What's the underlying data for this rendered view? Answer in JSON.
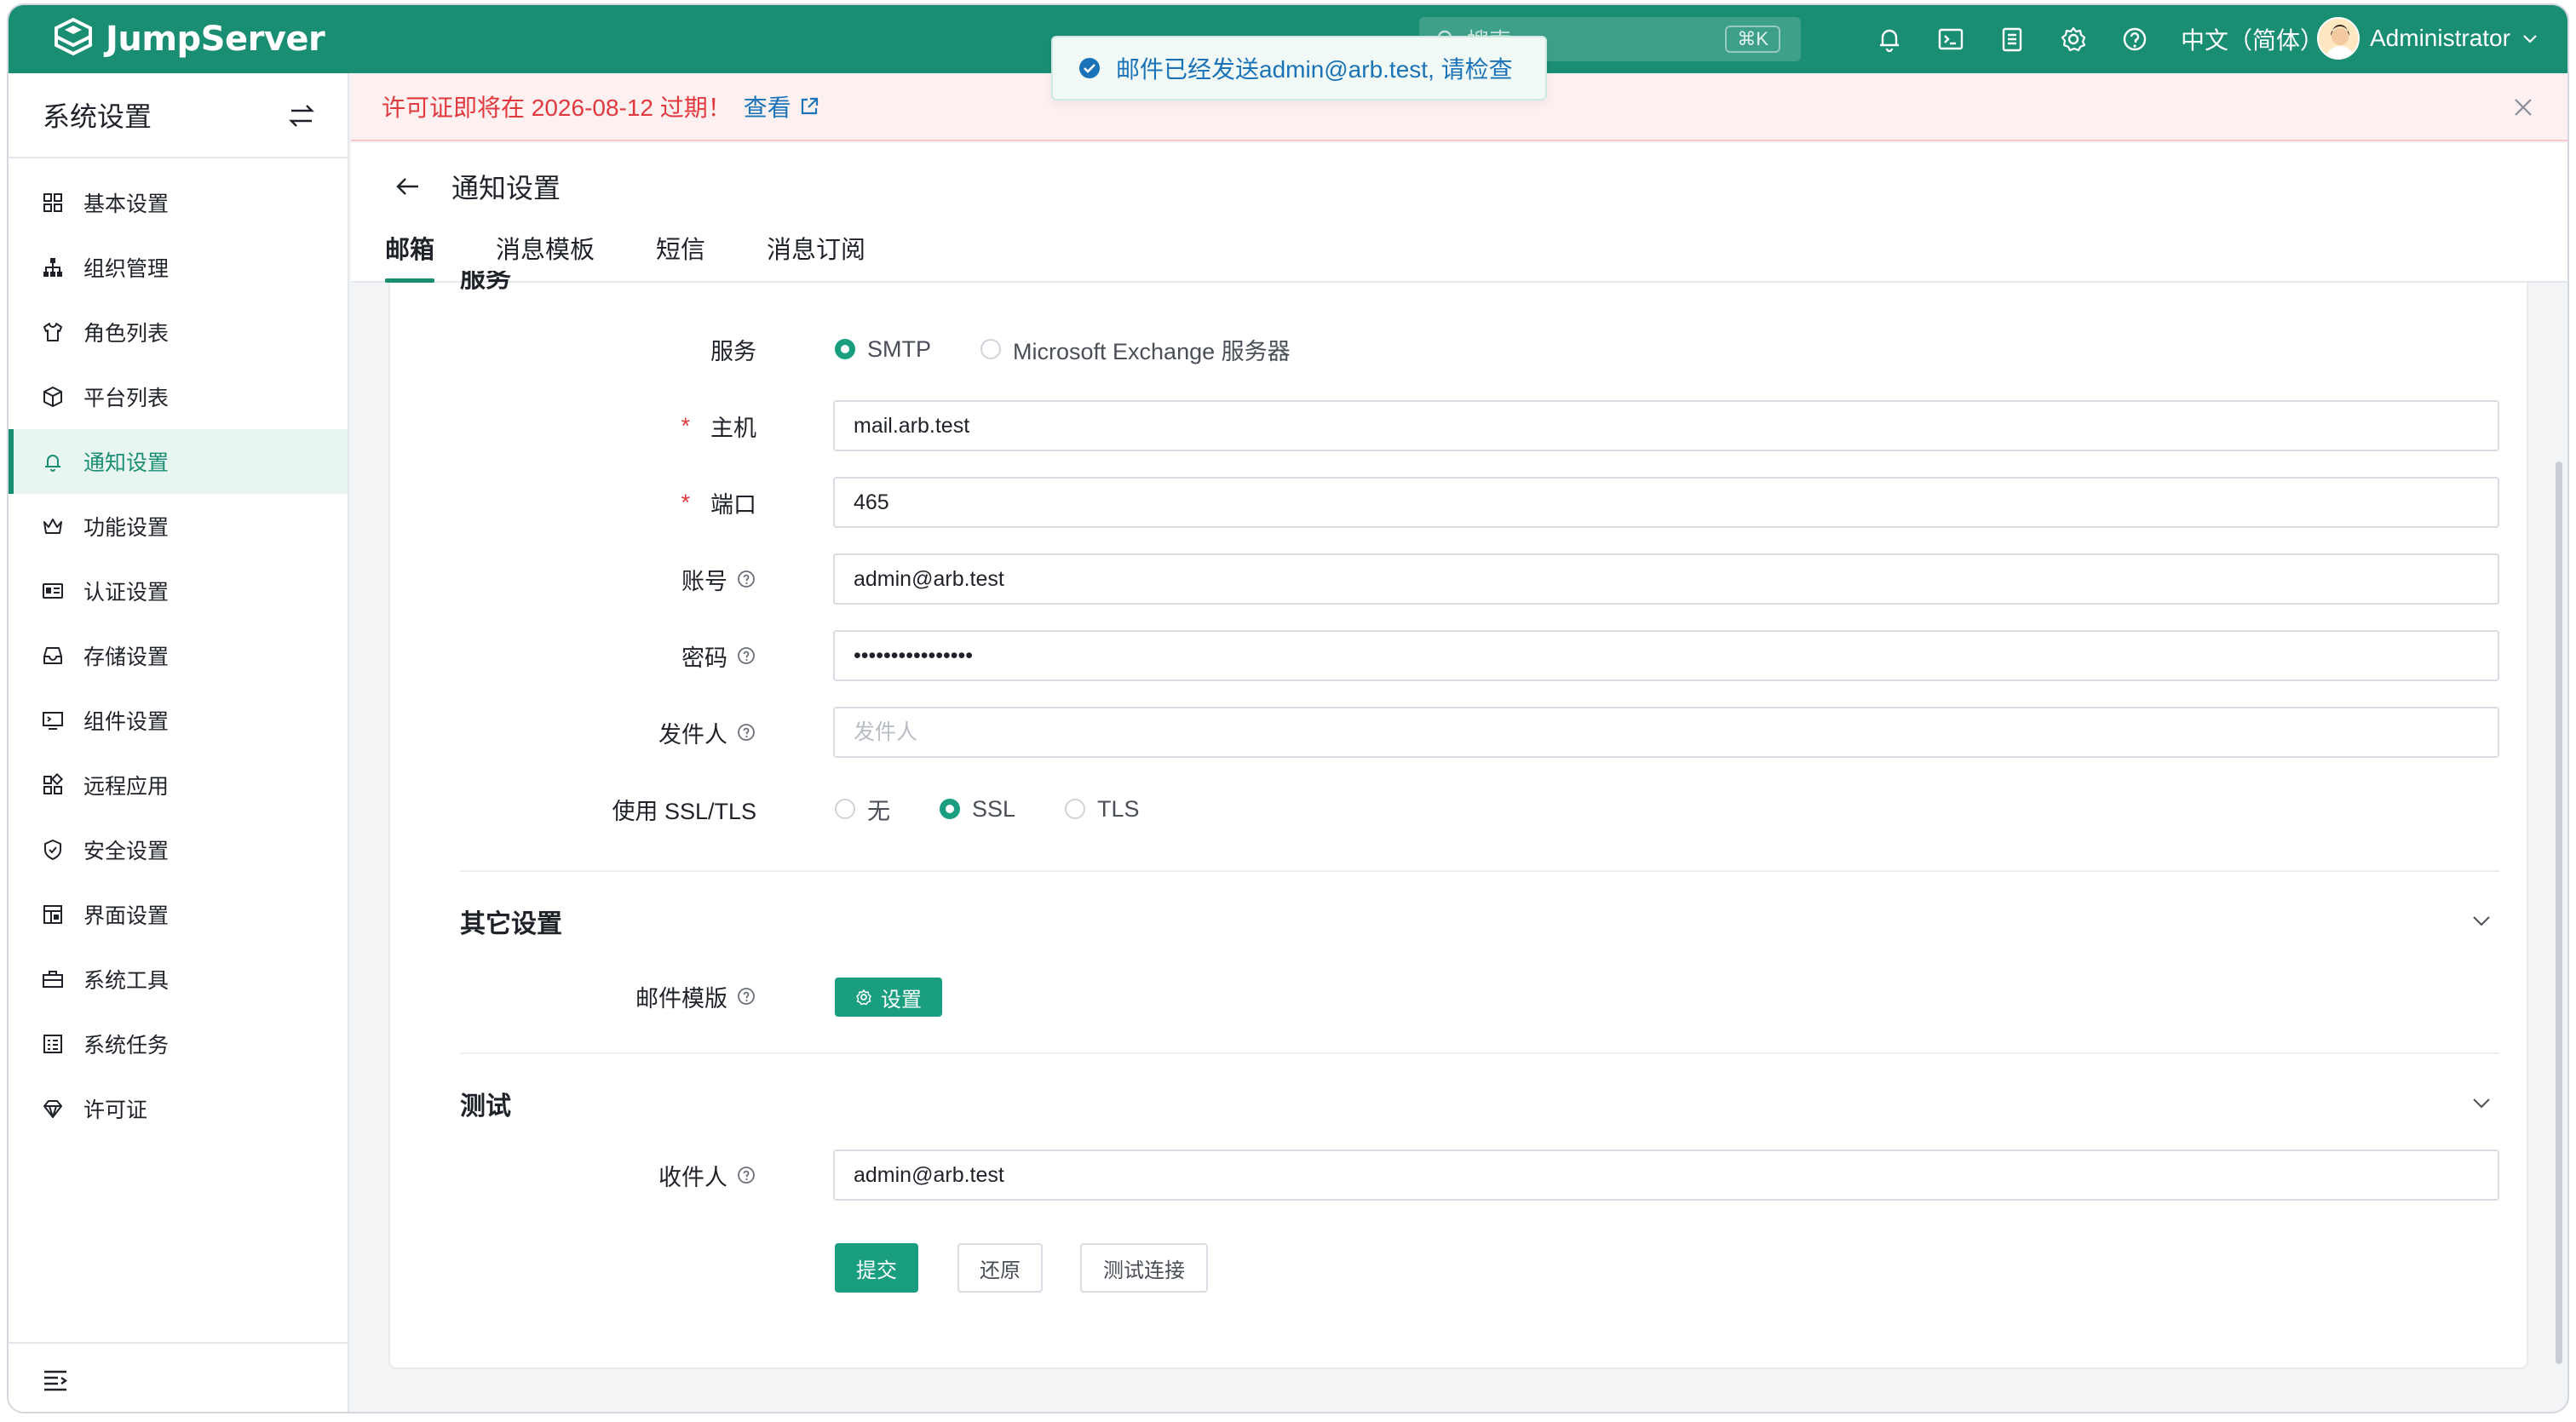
{
  "app": {
    "name": "JumpServer"
  },
  "topbar": {
    "search_placeholder": "搜索",
    "search_shortcut": "⌘K",
    "language": "中文（简体）",
    "user": "Administrator",
    "icons": [
      "bell-icon",
      "terminal-icon",
      "clipboard-icon",
      "gear-icon",
      "help-icon"
    ]
  },
  "toast": {
    "message": "邮件已经发送admin@arb.test, 请检查"
  },
  "sidebar": {
    "title": "系统设置",
    "items": [
      {
        "label": "基本设置",
        "icon": "grid-icon"
      },
      {
        "label": "组织管理",
        "icon": "org-tree-icon"
      },
      {
        "label": "角色列表",
        "icon": "shirt-icon"
      },
      {
        "label": "平台列表",
        "icon": "cube-icon"
      },
      {
        "label": "通知设置",
        "icon": "bell-icon",
        "active": true
      },
      {
        "label": "功能设置",
        "icon": "crown-icon"
      },
      {
        "label": "认证设置",
        "icon": "id-card-icon"
      },
      {
        "label": "存储设置",
        "icon": "inbox-icon"
      },
      {
        "label": "组件设置",
        "icon": "monitor-icon"
      },
      {
        "label": "远程应用",
        "icon": "apps-icon"
      },
      {
        "label": "安全设置",
        "icon": "shield-icon"
      },
      {
        "label": "界面设置",
        "icon": "layout-icon"
      },
      {
        "label": "系统工具",
        "icon": "toolbox-icon"
      },
      {
        "label": "系统任务",
        "icon": "task-list-icon"
      },
      {
        "label": "许可证",
        "icon": "diamond-icon"
      }
    ]
  },
  "license_banner": {
    "text": "许可证即将在 2026-08-12 过期！",
    "link": "查看"
  },
  "page": {
    "title": "通知设置",
    "tabs": [
      {
        "label": "邮箱",
        "active": true
      },
      {
        "label": "消息模板"
      },
      {
        "label": "短信"
      },
      {
        "label": "消息订阅"
      }
    ]
  },
  "form": {
    "cut_section": "服务",
    "service": {
      "label": "服务",
      "options": [
        "SMTP",
        "Microsoft Exchange 服务器"
      ],
      "selected": "SMTP"
    },
    "host": {
      "label": "主机",
      "required": true,
      "value": "mail.arb.test"
    },
    "port": {
      "label": "端口",
      "required": true,
      "value": "465"
    },
    "account": {
      "label": "账号",
      "value": "admin@arb.test"
    },
    "password": {
      "label": "密码",
      "value": "••••••••••••••••"
    },
    "sender": {
      "label": "发件人",
      "placeholder": "发件人",
      "value": ""
    },
    "ssl": {
      "label": "使用 SSL/TLS",
      "options": [
        "无",
        "SSL",
        "TLS"
      ],
      "selected": "SSL"
    },
    "other": {
      "title": "其它设置",
      "template_label": "邮件模版",
      "template_button": "设置"
    },
    "test": {
      "title": "测试",
      "recipient_label": "收件人",
      "recipient_value": "admin@arb.test"
    },
    "actions": {
      "submit": "提交",
      "reset": "还原",
      "test_connection": "测试连接"
    }
  },
  "colors": {
    "brand": "#1a8e73",
    "primary": "#1a9e80",
    "danger": "#e0393e",
    "link": "#1a73b8"
  }
}
